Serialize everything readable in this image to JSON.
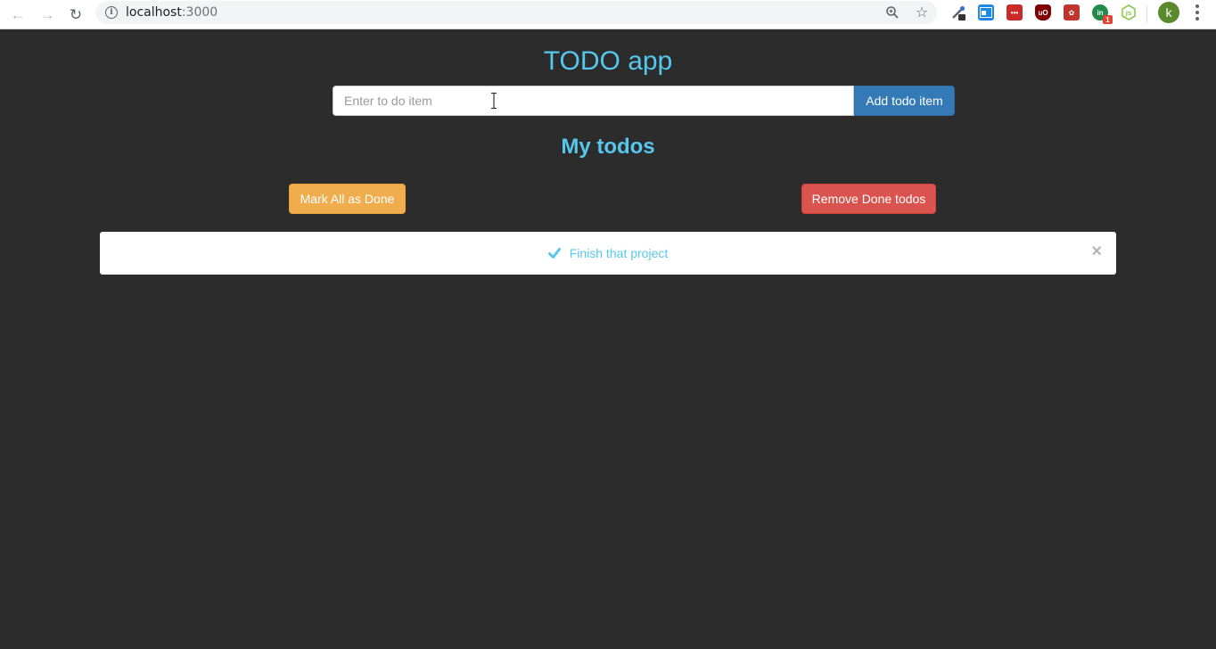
{
  "browser": {
    "url_host": "localhost",
    "url_port": ":3000",
    "profile_initial": "k",
    "extension_badge": "1"
  },
  "app": {
    "title": "TODO app",
    "input_placeholder": "Enter to do item",
    "input_value": "",
    "add_button_label": "Add todo item",
    "list_title": "My todos",
    "mark_all_label": "Mark All as Done",
    "remove_done_label": "Remove Done todos"
  },
  "todos": [
    {
      "text": "Finish that project",
      "done": true
    }
  ],
  "colors": {
    "background": "#2c2c2c",
    "accent_text": "#56c8ee",
    "primary_button": "#337ab7",
    "warning_button": "#f0ad4e",
    "danger_button": "#d9534f"
  },
  "icons": {
    "back": "back-arrow-icon",
    "forward": "forward-arrow-icon",
    "reload": "reload-icon",
    "site_info": "info-icon",
    "zoom": "zoom-icon",
    "bookmark": "star-icon",
    "todo_done": "check-icon",
    "todo_remove": "close-icon"
  }
}
